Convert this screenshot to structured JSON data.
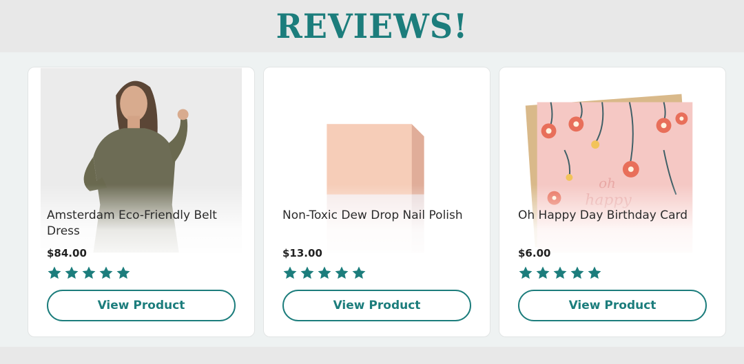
{
  "header": {
    "title": "REVIEWS!"
  },
  "colors": {
    "accent": "#1c7d7c",
    "star": "#1c7d7c",
    "background": "#eef2f2"
  },
  "products": [
    {
      "title": "Amsterdam Eco-Friendly Belt Dress",
      "price": "$84.00",
      "rating": 5,
      "button": "View Product",
      "image": "woman-in-olive-dress"
    },
    {
      "title": "Non-Toxic Dew Drop Nail Polish",
      "price": "$13.00",
      "rating": 5,
      "button": "View Product",
      "image": "peach-nail-polish-bottle"
    },
    {
      "title": "Oh Happy Day Birthday Card",
      "price": "$6.00",
      "rating": 5,
      "button": "View Product",
      "image": "floral-birthday-card"
    }
  ]
}
